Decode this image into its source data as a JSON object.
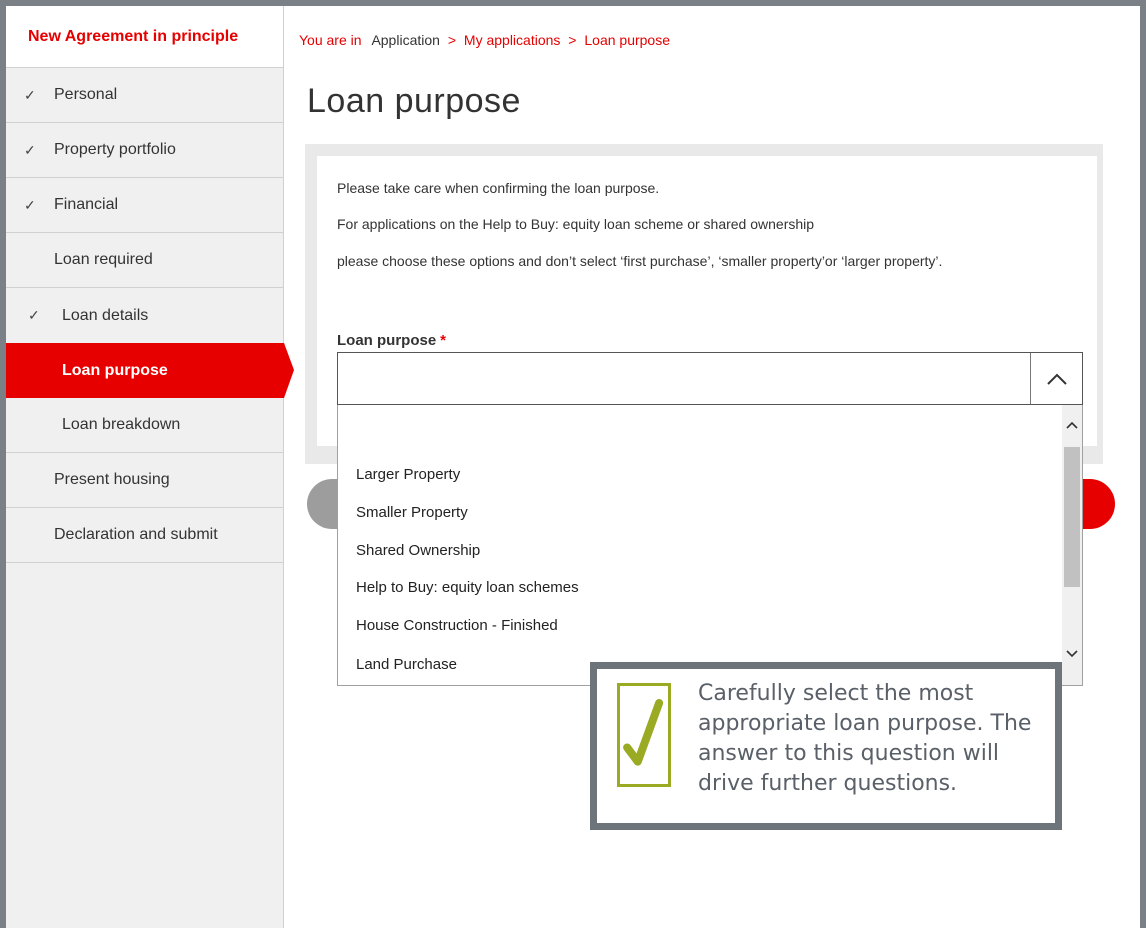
{
  "sidebar": {
    "header": "New Agreement in principle",
    "items": [
      {
        "label": "Personal",
        "check": "✓"
      },
      {
        "label": "Property portfolio",
        "check": "✓"
      },
      {
        "label": "Financial",
        "check": "✓"
      },
      {
        "label": "Loan required",
        "check": ""
      },
      {
        "label": "Loan details",
        "check": "✓"
      },
      {
        "label": "Loan purpose",
        "check": ""
      },
      {
        "label": "Loan breakdown",
        "check": ""
      },
      {
        "label": "Present housing",
        "check": ""
      },
      {
        "label": "Declaration and submit",
        "check": ""
      }
    ]
  },
  "breadcrumb": {
    "prefix": "You are in",
    "items": [
      "Application",
      "My applications",
      "Loan purpose"
    ],
    "separator": ">"
  },
  "page_title": "Loan purpose",
  "info": {
    "line1": "Please take care when confirming the loan purpose.",
    "line2": "For applications on the Help to Buy: equity loan scheme or shared ownership",
    "line3": "please choose these options and don’t select ‘first purchase’, ‘smaller property’or ‘larger property’."
  },
  "field": {
    "label": "Loan purpose",
    "required_mark": "*",
    "value": "",
    "arrow_icon": "chevron-up-icon"
  },
  "dropdown": {
    "options": [
      "",
      "Larger Property",
      "Smaller Property",
      "Shared Ownership",
      "Help to Buy: equity loan schemes",
      "House Construction - Finished",
      "Land Purchase"
    ]
  },
  "callout": {
    "icon": "checkmark-icon",
    "text": "Carefully select the most appropriate loan purpose. The answer to this question will drive further questions."
  },
  "colors": {
    "accent": "#e60000",
    "sidebar_bg": "#f0f0f0",
    "callout_border": "#6e757a",
    "check_green": "#9aaa22"
  }
}
